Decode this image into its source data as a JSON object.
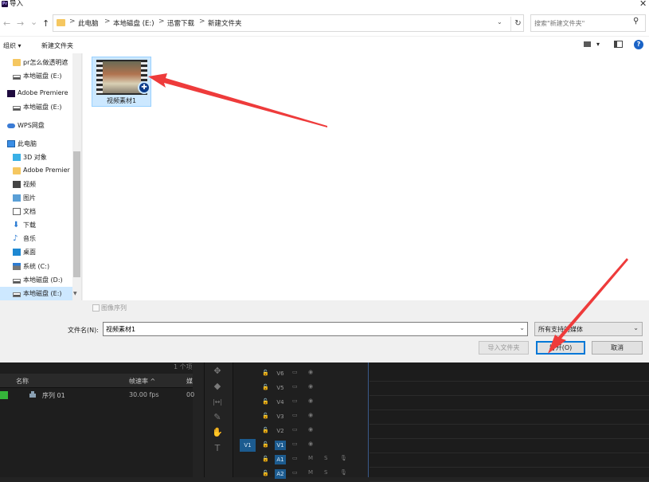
{
  "dialog": {
    "title": "导入",
    "nav": {
      "back": "←",
      "forward": "→",
      "down": "⌄",
      "up": "↑"
    },
    "address": {
      "crumbs": [
        "此电脑",
        "本地磁盘 (E:)",
        "迅雷下载",
        "新建文件夹"
      ],
      "separator": ">"
    },
    "search_placeholder": "搜索\"新建文件夹\"",
    "commands": {
      "organize": "组织 ▾",
      "new_folder": "新建文件夹"
    },
    "sidebar": [
      {
        "label": "pr怎么做透明遮",
        "icon": "folder-icon"
      },
      {
        "label": "本地磁盘 (E:)",
        "icon": "drive-icon"
      },
      {
        "label": "Adobe Premiere",
        "icon": "premiere-icon"
      },
      {
        "label": "本地磁盘 (E:)",
        "icon": "drive-icon"
      },
      {
        "label": "WPS网盘",
        "icon": "cloud-icon"
      },
      {
        "label": "此电脑",
        "icon": "computer-icon"
      },
      {
        "label": "3D 对象",
        "icon": "3d-objects-icon"
      },
      {
        "label": "Adobe Premier",
        "icon": "folder-icon"
      },
      {
        "label": "视频",
        "icon": "video-icon"
      },
      {
        "label": "图片",
        "icon": "pictures-icon"
      },
      {
        "label": "文档",
        "icon": "documents-icon"
      },
      {
        "label": "下载",
        "icon": "download-icon"
      },
      {
        "label": "音乐",
        "icon": "music-icon"
      },
      {
        "label": "桌面",
        "icon": "desktop-icon"
      },
      {
        "label": "系统 (C:)",
        "icon": "system-drive-icon"
      },
      {
        "label": "本地磁盘 (D:)",
        "icon": "drive-icon"
      },
      {
        "label": "本地磁盘 (E:)",
        "icon": "drive-icon"
      }
    ],
    "file": {
      "name": "视频素材1"
    },
    "image_sequence_label": "图像序列",
    "filename_label": "文件名(N):",
    "filename_value": "视频素材1",
    "file_type": "所有支持的媒体",
    "buttons": {
      "import_folder": "导入文件夹",
      "open": "打开(O)",
      "cancel": "取消"
    },
    "close": "✕"
  },
  "premiere": {
    "project": {
      "top_info": "1 个项",
      "columns": [
        "名称",
        "帧速率 ^",
        "媒"
      ],
      "rows": [
        {
          "name": "序列 01",
          "fps": "30.00 fps",
          "extra": "00"
        }
      ]
    },
    "tools": [
      "✥",
      "◆",
      "|↔|",
      "✎",
      "✋",
      "T"
    ],
    "tracks": [
      {
        "name": "V6",
        "kind": "video",
        "active": false
      },
      {
        "name": "V5",
        "kind": "video",
        "active": false
      },
      {
        "name": "V4",
        "kind": "video",
        "active": false
      },
      {
        "name": "V3",
        "kind": "video",
        "active": false
      },
      {
        "name": "V2",
        "kind": "video",
        "active": false
      },
      {
        "name": "V1",
        "kind": "video",
        "active": true
      },
      {
        "name": "A1",
        "kind": "audio",
        "active": true
      },
      {
        "name": "A2",
        "kind": "audio",
        "active": true
      }
    ],
    "source_patch": "V1"
  },
  "colors": {
    "selection": "#cce8ff",
    "accent": "#0078d7",
    "annotation_arrow": "#ee3b3b"
  }
}
